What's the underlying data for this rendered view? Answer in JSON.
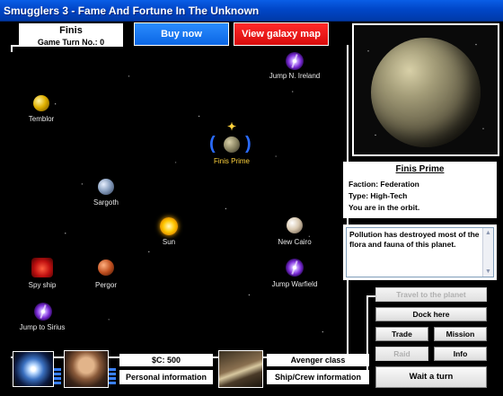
{
  "window": {
    "title": "Smugglers 3 - Fame And Fortune In The Unknown"
  },
  "header": {
    "location_name": "Finis",
    "turn_label": "Game Turn No.: 0",
    "buy_now": "Buy now",
    "view_galaxy_map": "View galaxy map"
  },
  "map": {
    "bodies": [
      {
        "name": "Jump N. Ireland",
        "kind": "portal"
      },
      {
        "name": "Temblor",
        "kind": "planet"
      },
      {
        "name": "Finis Prime",
        "kind": "planet-current"
      },
      {
        "name": "Sargoth",
        "kind": "planet"
      },
      {
        "name": "Sun",
        "kind": "star"
      },
      {
        "name": "New Cairo",
        "kind": "planet"
      },
      {
        "name": "Spy ship",
        "kind": "ship"
      },
      {
        "name": "Pergor",
        "kind": "planet"
      },
      {
        "name": "Jump Warfield",
        "kind": "portal"
      },
      {
        "name": "Jump to Sirius",
        "kind": "portal"
      }
    ]
  },
  "planet_info": {
    "title": "Finis Prime",
    "faction": "Faction: Federation",
    "type": "Type: High-Tech",
    "status": "You are in the orbit.",
    "description": "Pollution has destroyed most of the flora and fauna of this planet."
  },
  "actions": {
    "travel": "Travel to the planet",
    "dock": "Dock here",
    "trade": "Trade",
    "mission": "Mission",
    "raid": "Raid",
    "info": "Info",
    "wait": "Wait a turn"
  },
  "bottom": {
    "credits": "$C: 500",
    "personal_info": "Personal information",
    "ship_class": "Avenger class",
    "ship_crew_info": "Ship/Crew information"
  },
  "colors": {
    "title_bar": "#0046c8",
    "buy_blue": "#0b66e4",
    "map_red": "#d80c0c",
    "label_yellow": "#ffd23c"
  }
}
